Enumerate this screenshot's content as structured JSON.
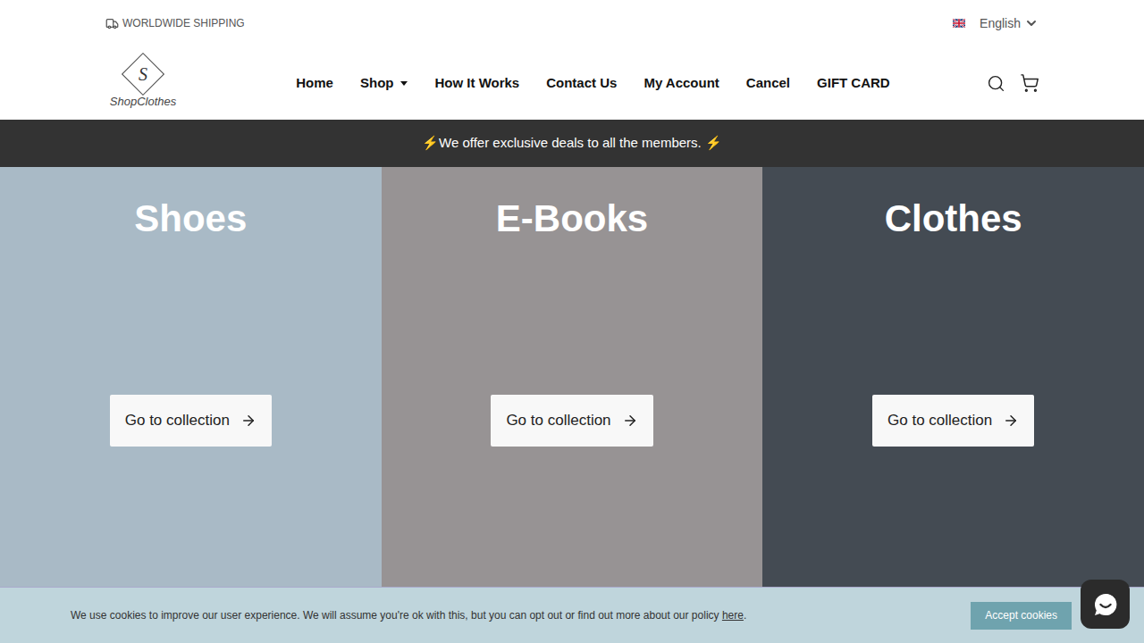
{
  "top_bar": {
    "shipping": "WORLDWIDE SHIPPING",
    "language": "English"
  },
  "logo": {
    "mark": "S",
    "name": "ShopClothes"
  },
  "nav": [
    {
      "label": "Home",
      "dropdown": false
    },
    {
      "label": "Shop",
      "dropdown": true
    },
    {
      "label": "How It Works",
      "dropdown": false
    },
    {
      "label": "Contact Us",
      "dropdown": false
    },
    {
      "label": "My Account",
      "dropdown": false
    },
    {
      "label": "Cancel",
      "dropdown": false
    },
    {
      "label": "GIFT CARD",
      "dropdown": false
    }
  ],
  "banner": "⚡We offer exclusive deals to all the members. ⚡",
  "collections": [
    {
      "title": "Shoes",
      "button": "Go to collection",
      "color": "#a9bac6"
    },
    {
      "title": "E-Books",
      "button": "Go to collection",
      "color": "#979394"
    },
    {
      "title": "Clothes",
      "button": "Go to collection",
      "color": "#444b53"
    }
  ],
  "cookie_bar": {
    "text": "We use cookies to improve our user experience. We will assume you're ok with this, but you can opt out or find out more about our policy ",
    "link": "here",
    "end": ".",
    "button": "Accept cookies"
  }
}
